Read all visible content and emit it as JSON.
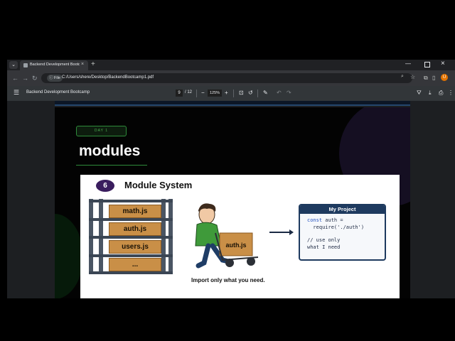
{
  "browser": {
    "tab_title": "Backend Development Bootcamp",
    "tab_close": "×",
    "new_tab": "+",
    "url_chip": "File",
    "url": "C:/Users/shere/Desktop/BackendBootcamp1.pdf",
    "avatar_initial": "U"
  },
  "pdf_toolbar": {
    "document_title": "Backend Development Bootcamp",
    "current_page": "9",
    "total_pages": "/ 12",
    "zoom": "125%",
    "zoom_out": "−",
    "zoom_in": "+"
  },
  "page": {
    "day_badge": "DAY 1",
    "heading": "modules"
  },
  "slide": {
    "number": "6",
    "title": "Module System",
    "shelf_boxes": [
      "math.js",
      "auth.js",
      "users.js",
      "..."
    ],
    "cart_box": "auth.js",
    "caption": "Import only what you need.",
    "card_title": "My Project",
    "code_line1_kw": "const",
    "code_line1_rest": " auth =",
    "code_line2": "  require('./auth')",
    "code_line3": "// use only",
    "code_line4": "what I need"
  },
  "colors": {
    "accent_green": "#4caf50",
    "card_navy": "#1e3a5f",
    "badge_purple": "#3a1d5e",
    "box_wood": "#c98f47"
  }
}
